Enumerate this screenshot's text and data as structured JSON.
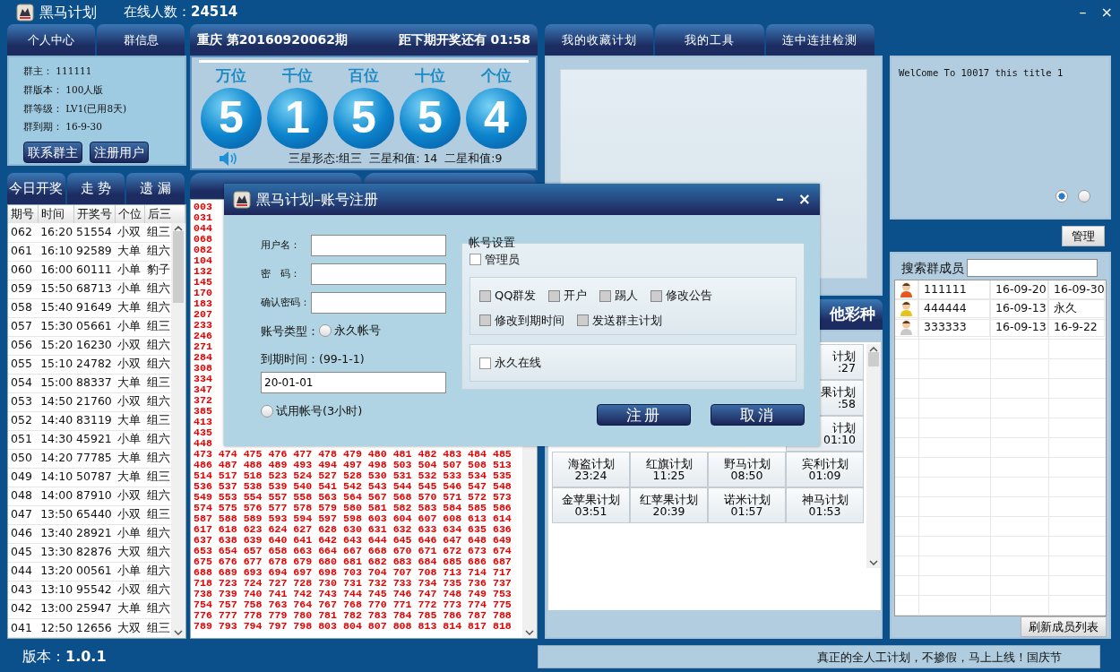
{
  "app": {
    "title": "黑马计划",
    "online_label": "在线人数：",
    "online_count": "24514",
    "window_buttons": [
      "–",
      "×"
    ]
  },
  "profile_tabs": [
    "个人中心",
    "群信息"
  ],
  "group_info": [
    {
      "label": "群主：",
      "value": "111111"
    },
    {
      "label": "群版本：",
      "value": "100人版"
    },
    {
      "label": "群等级：",
      "value": "LV1(已用8天)"
    },
    {
      "label": "群到期：",
      "value": "16-9-30"
    }
  ],
  "info_buttons": [
    "联系群主",
    "注册用户"
  ],
  "draw": {
    "region": "重庆",
    "period": "第20160920062期",
    "countdown_label": "距下期开奖还有",
    "countdown": "01:58",
    "positions": [
      {
        "label": "万位",
        "digit": "5"
      },
      {
        "label": "千位",
        "digit": "1"
      },
      {
        "label": "百位",
        "digit": "5"
      },
      {
        "label": "十位",
        "digit": "5"
      },
      {
        "label": "个位",
        "digit": "4"
      }
    ],
    "stats": [
      "三星形态:组三",
      "三星和值: 14",
      "二星和值:9"
    ]
  },
  "history_tabs": [
    "今日开奖",
    "走 势",
    "遗 漏"
  ],
  "history": {
    "columns": [
      "期号",
      "时间",
      "开奖号",
      "个位",
      "后三"
    ],
    "rows": [
      [
        "062",
        "16:20",
        "51554",
        "小双",
        "组三"
      ],
      [
        "061",
        "16:10",
        "92589",
        "大单",
        "组六"
      ],
      [
        "060",
        "16:00",
        "60111",
        "小单",
        "豹子"
      ],
      [
        "059",
        "15:50",
        "68713",
        "小单",
        "组六"
      ],
      [
        "058",
        "15:40",
        "91649",
        "大单",
        "组六"
      ],
      [
        "057",
        "15:30",
        "05661",
        "小单",
        "组三"
      ],
      [
        "056",
        "15:20",
        "16230",
        "小双",
        "组六"
      ],
      [
        "055",
        "15:10",
        "24782",
        "小双",
        "组六"
      ],
      [
        "054",
        "15:00",
        "88337",
        "大单",
        "组三"
      ],
      [
        "053",
        "14:50",
        "21760",
        "小双",
        "组六"
      ],
      [
        "052",
        "14:40",
        "83119",
        "大单",
        "组三"
      ],
      [
        "051",
        "14:30",
        "45921",
        "小单",
        "组六"
      ],
      [
        "050",
        "14:20",
        "77785",
        "大单",
        "组六"
      ],
      [
        "049",
        "14:10",
        "50787",
        "大单",
        "组三"
      ],
      [
        "048",
        "14:00",
        "87910",
        "小双",
        "组六"
      ],
      [
        "047",
        "13:50",
        "65440",
        "小双",
        "组三"
      ],
      [
        "046",
        "13:40",
        "28921",
        "小单",
        "组六"
      ],
      [
        "045",
        "13:30",
        "82876",
        "大双",
        "组六"
      ],
      [
        "044",
        "13:20",
        "00561",
        "小单",
        "组六"
      ],
      [
        "043",
        "13:10",
        "95542",
        "小双",
        "组六"
      ],
      [
        "042",
        "13:00",
        "25947",
        "大单",
        "组六"
      ],
      [
        "041",
        "12:50",
        "12656",
        "大双",
        "组三"
      ]
    ]
  },
  "numbers": [
    "003",
    "031",
    "044",
    "068",
    "082",
    "104",
    "132",
    "145",
    "170",
    "183",
    "207",
    "233",
    "246",
    "271",
    "284",
    "308",
    "334",
    "347",
    "372",
    "385",
    "413",
    "435",
    "448",
    "473 474 475 476 477 478 479 480 481 482 483 484 485",
    "486 487 488 489 493 494 497 498 503 504 507 508 513",
    "514 517 518 523 524 527 528 530 531 532 533 534 535",
    "536 537 538 539 540 541 542 543 544 545 546 547 548",
    "549 553 554 557 558 563 564 567 568 570 571 572 573",
    "574 575 576 577 578 579 580 581 582 583 584 585 586",
    "587 588 589 593 594 597 598 603 604 607 608 613 614",
    "617 618 623 624 627 628 630 631 632 633 634 635 636",
    "637 638 639 640 641 642 643 644 645 646 647 648 649",
    "653 654 657 658 663 664 667 668 670 671 672 673 674",
    "675 676 677 678 679 680 681 682 683 684 685 686 687",
    "688 689 693 694 697 698 703 704 707 708 713 714 717",
    "718 723 724 727 728 730 731 732 733 734 735 736 737",
    "738 739 740 741 742 743 744 745 746 747 748 749 753",
    "754 757 758 763 764 767 768 770 771 772 773 774 775",
    "776 777 778 779 780 781 782 783 784 785 786 787 788",
    "789 793 794 797 798 803 804 807 808 813 814 817 818"
  ],
  "plan_tabs": [
    "我的收藏计划",
    "我的工具",
    "连中连挂检测"
  ],
  "other_tab": "他彩种",
  "plans": [
    [
      {
        "kind": "clipped",
        "name": "计划",
        "time": ":27"
      }
    ],
    [
      {
        "kind": "clipped",
        "name": "果计划",
        "time": ":58"
      }
    ],
    [
      {
        "kind": "clipped",
        "name": "计划",
        "time": "01:10"
      }
    ],
    [
      {
        "kind": "full",
        "name": "海盗计划",
        "time": "23:24"
      },
      {
        "kind": "full",
        "name": "红旗计划",
        "time": "11:25"
      },
      {
        "kind": "full",
        "name": "野马计划",
        "time": "08:50"
      },
      {
        "kind": "full",
        "name": "宾利计划",
        "time": "01:09"
      }
    ],
    [
      {
        "kind": "full",
        "name": "金苹果计划",
        "time": "03:51"
      },
      {
        "kind": "full",
        "name": "红苹果计划",
        "time": "20:39"
      },
      {
        "kind": "full",
        "name": "诺米计划",
        "time": "01:57"
      },
      {
        "kind": "full",
        "name": "神马计划",
        "time": "01:53"
      }
    ]
  ],
  "notice": {
    "text": "WelCome To 10017 this title 1",
    "pages": [
      {
        "selected": true
      },
      {
        "selected": false
      }
    ]
  },
  "manage_button": "管理",
  "members": {
    "search_label": "搜索群成员",
    "rows": [
      {
        "color": "#e2581e",
        "id": "111111",
        "joined": "16-09-20",
        "expires": "16-09-30"
      },
      {
        "color": "#e8c21c",
        "id": "444444",
        "joined": "16-09-13",
        "expires": "永久"
      },
      {
        "color": "#c8c8c8",
        "id": "333333",
        "joined": "16-09-13",
        "expires": "16-9-22"
      }
    ],
    "refresh_button": "刷新成员列表"
  },
  "version": {
    "label": "版本：",
    "value": "1.0.1"
  },
  "status_text": "真正的全人工计划，不掺假，马上上线！国庆节",
  "dialog": {
    "title": "黑马计划–账号注册",
    "window_buttons": [
      "–",
      "×"
    ],
    "fields": [
      {
        "label": "用户名："
      },
      {
        "label": "密　码："
      },
      {
        "label": "确认密码："
      }
    ],
    "account_type_label": "账号类型：",
    "types": [
      {
        "label": "永久帐号",
        "selected": false
      },
      {
        "label": "试用帐号(3小时)",
        "selected": false
      }
    ],
    "expiry_label": "到期时间：(99-1-1)",
    "expiry_value": "20-01-01",
    "settings_title": "帐号设置",
    "admin": {
      "label": "管理员",
      "checked": false,
      "disabled": false
    },
    "permissions": [
      {
        "label": "QQ群发",
        "checked": false,
        "disabled": true
      },
      {
        "label": "开户",
        "checked": false,
        "disabled": true
      },
      {
        "label": "踢人",
        "checked": false,
        "disabled": true
      },
      {
        "label": "修改公告",
        "checked": false,
        "disabled": true
      },
      {
        "label": "修改到期时间",
        "checked": false,
        "disabled": true
      },
      {
        "label": "发送群主计划",
        "checked": false,
        "disabled": true
      }
    ],
    "always_online": {
      "label": "永久在线",
      "checked": false,
      "disabled": false
    },
    "buttons": [
      "注册",
      "取消"
    ]
  }
}
